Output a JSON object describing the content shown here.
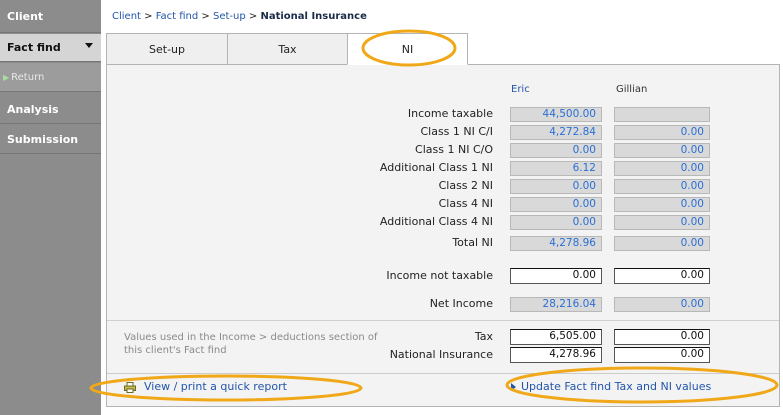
{
  "sidebar": {
    "items": [
      {
        "label": "Client"
      },
      {
        "label": "Fact find"
      },
      {
        "label": "Return"
      },
      {
        "label": "Analysis"
      },
      {
        "label": "Submission"
      }
    ]
  },
  "breadcrumb": {
    "client": "Client",
    "fact_find": "Fact find",
    "setup": "Set-up",
    "current": "National Insurance",
    "sep": " > "
  },
  "tabs": [
    {
      "label": "Set-up"
    },
    {
      "label": "Tax"
    },
    {
      "label": "NI"
    }
  ],
  "columns": {
    "eric": "Eric",
    "gillian": "Gillian"
  },
  "rows": [
    {
      "label": "Income taxable",
      "eric": "44,500.00",
      "gillian": ""
    },
    {
      "label": "Class 1 NI C/I",
      "eric": "4,272.84",
      "gillian": "0.00"
    },
    {
      "label": "Class 1 NI C/O",
      "eric": "0.00",
      "gillian": "0.00"
    },
    {
      "label": "Additional Class 1 NI",
      "eric": "6.12",
      "gillian": "0.00"
    },
    {
      "label": "Class 2 NI",
      "eric": "0.00",
      "gillian": "0.00"
    },
    {
      "label": "Class 4 NI",
      "eric": "0.00",
      "gillian": "0.00"
    },
    {
      "label": "Additional Class 4 NI",
      "eric": "0.00",
      "gillian": "0.00"
    },
    {
      "label": "Total NI",
      "eric": "4,278.96",
      "gillian": "0.00"
    },
    {
      "label": "Income not taxable",
      "eric": "0.00",
      "gillian": "0.00"
    },
    {
      "label": "Net Income",
      "eric": "28,216.04",
      "gillian": "0.00"
    }
  ],
  "deductions": {
    "note": "Values used in the Income > deductions section of this client's Fact find",
    "tax_label": "Tax",
    "tax_eric": "6,505.00",
    "tax_gillian": "0.00",
    "ni_label": "National Insurance",
    "ni_eric": "4,278.96",
    "ni_gillian": "0.00"
  },
  "footer": {
    "quick_report": "View / print a quick report",
    "update": "Update Fact find Tax and NI values"
  },
  "colors": {
    "highlight": "#f0a818",
    "link": "#2255aa",
    "value": "#2a6fd6"
  }
}
